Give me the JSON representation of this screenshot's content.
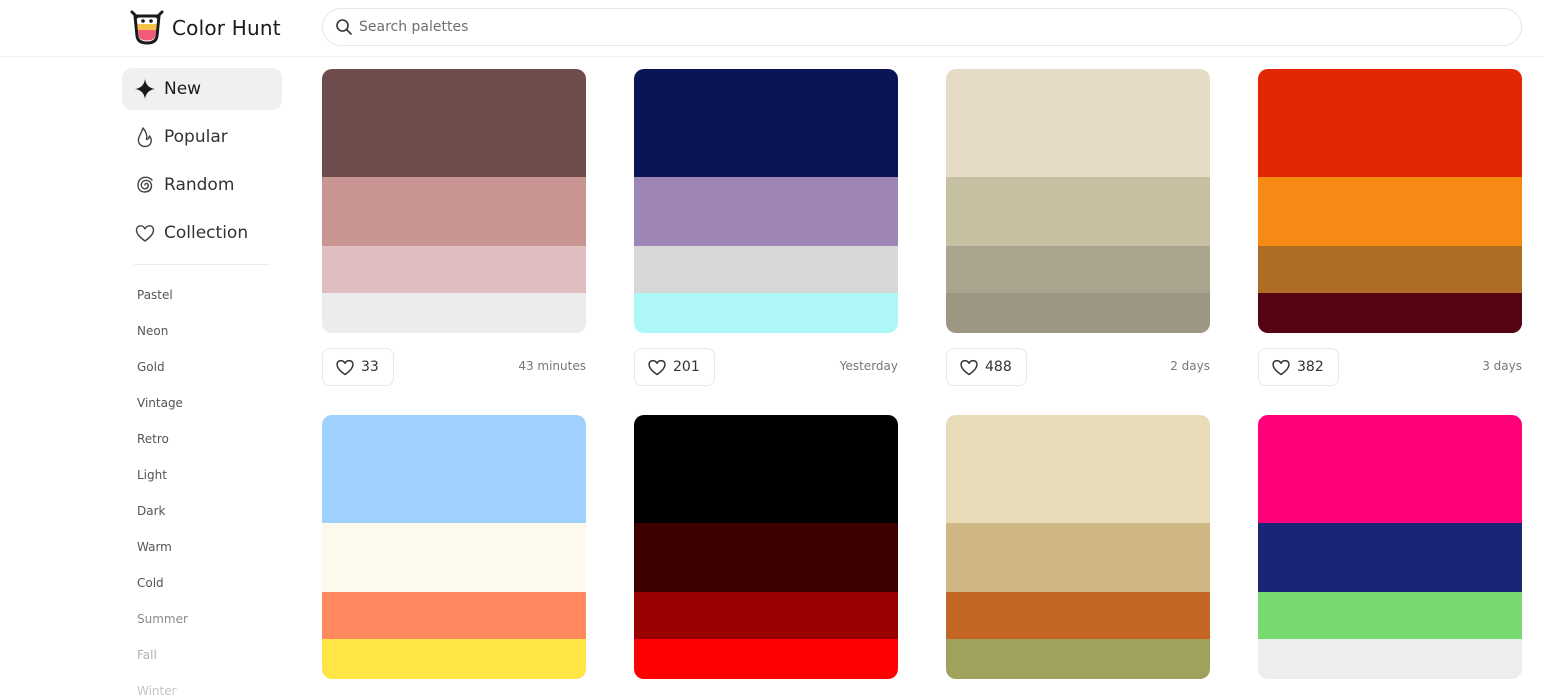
{
  "app": {
    "name": "Color Hunt"
  },
  "search": {
    "placeholder": "Search palettes",
    "value": ""
  },
  "sidebar": {
    "nav": [
      {
        "label": "New",
        "icon": "sparkle-icon",
        "active": true
      },
      {
        "label": "Popular",
        "icon": "flame-icon",
        "active": false
      },
      {
        "label": "Random",
        "icon": "spiral-icon",
        "active": false
      },
      {
        "label": "Collection",
        "icon": "heart-icon",
        "active": false
      }
    ],
    "tags": [
      {
        "label": "Pastel",
        "color": "#555555"
      },
      {
        "label": "Neon",
        "color": "#555555"
      },
      {
        "label": "Gold",
        "color": "#555555"
      },
      {
        "label": "Vintage",
        "color": "#555555"
      },
      {
        "label": "Retro",
        "color": "#555555"
      },
      {
        "label": "Light",
        "color": "#555555"
      },
      {
        "label": "Dark",
        "color": "#555555"
      },
      {
        "label": "Warm",
        "color": "#555555"
      },
      {
        "label": "Cold",
        "color": "#555555"
      },
      {
        "label": "Summer",
        "color": "#8a8a8a"
      },
      {
        "label": "Fall",
        "color": "#b0b0b0"
      },
      {
        "label": "Winter",
        "color": "#c4c4c4"
      }
    ]
  },
  "palettes": [
    {
      "colors": [
        "#6D4C4B",
        "#C89593",
        "#DEBEBF",
        "#ECECEC"
      ],
      "likes": "33",
      "date": "43 minutes"
    },
    {
      "colors": [
        "#0B1456",
        "#9D86B6",
        "#D7D7D7",
        "#AEF7F8"
      ],
      "likes": "201",
      "date": "Yesterday"
    },
    {
      "colors": [
        "#E6DCC5",
        "#C7BFA1",
        "#AAA48F",
        "#9C9682"
      ],
      "likes": "488",
      "date": "2 days"
    },
    {
      "colors": [
        "#E02602",
        "#F78A15",
        "#AF6D25",
        "#560411"
      ],
      "likes": "382",
      "date": "3 days"
    },
    {
      "colors": [
        "#A0D0FE",
        "#FDF9ED",
        "#FF885E",
        "#FFE545"
      ],
      "likes": "",
      "date": ""
    },
    {
      "colors": [
        "#000000",
        "#3C0000",
        "#990000",
        "#FF0000"
      ],
      "likes": "",
      "date": ""
    },
    {
      "colors": [
        "#E8DCB8",
        "#CEB784",
        "#C46726",
        "#A0A15B"
      ],
      "likes": "",
      "date": ""
    },
    {
      "colors": [
        "#FF007A",
        "#192675",
        "#77DA70",
        "#EDEDED"
      ],
      "likes": "",
      "date": ""
    }
  ]
}
